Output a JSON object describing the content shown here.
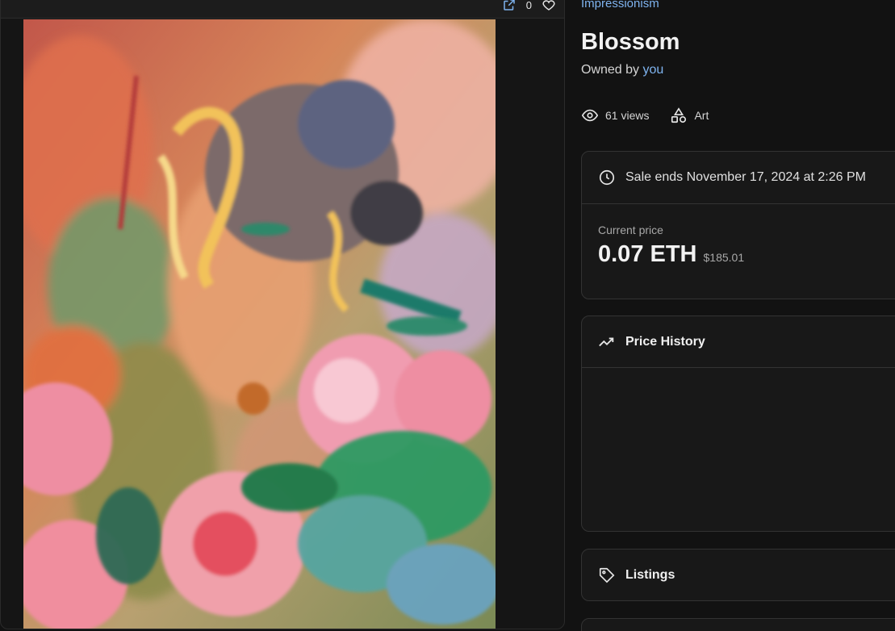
{
  "toolbar": {
    "like_count": "0",
    "icons": [
      "open-external-icon",
      "heart-icon"
    ]
  },
  "artwork": {
    "description_colors": {
      "background_warm": "#c5774f",
      "rose_pink": "#ee8ea2",
      "leaf_green": "#2e9a63",
      "cool_blue": "#5b8fbf",
      "ochre": "#8a7a3c"
    }
  },
  "item": {
    "collection": "Impressionism",
    "title": "Blossom",
    "owner_prefix": "Owned by",
    "owner": "you",
    "views": "61 views",
    "category": "Art"
  },
  "sale": {
    "ends_text": "Sale ends November 17, 2024 at 2:26 PM",
    "price_label": "Current price",
    "price_eth": "0.07 ETH",
    "price_usd": "$185.01"
  },
  "sections": {
    "price_history": "Price History",
    "listings": "Listings"
  },
  "colors": {
    "link": "#7fb4f0",
    "background": "#121212",
    "card": "#181818",
    "border": "#333333"
  }
}
